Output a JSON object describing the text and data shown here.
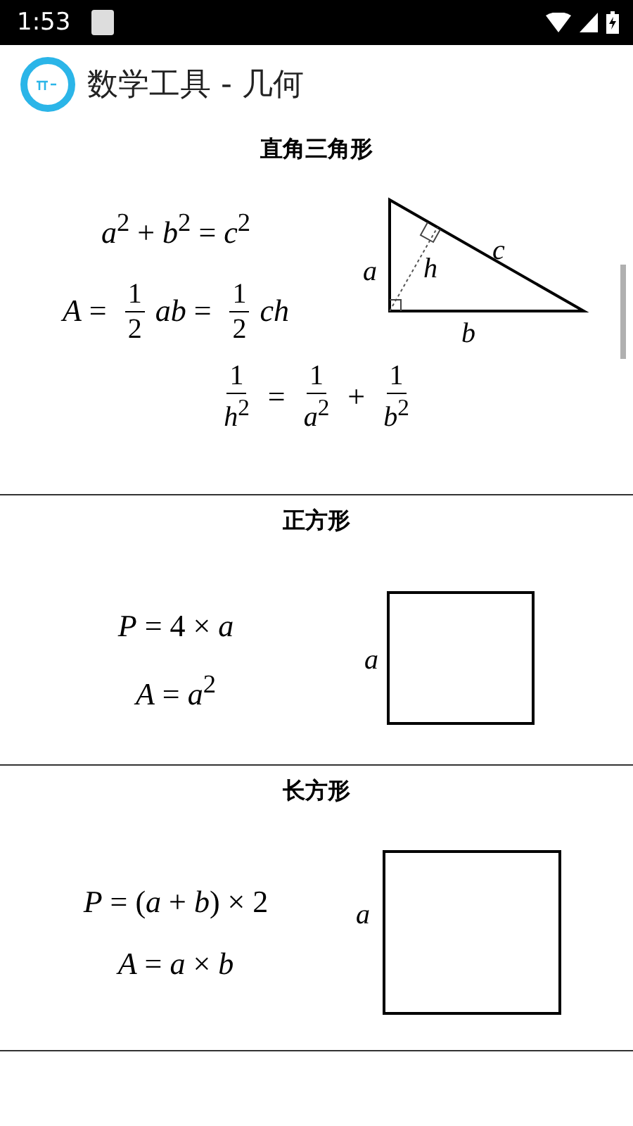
{
  "status_bar": {
    "time": "1:53"
  },
  "app_bar": {
    "title": "数学工具 - 几何"
  },
  "sections": [
    {
      "title": "直角三角形",
      "kind": "triangle",
      "formulas": [
        [
          {
            "t": "*a*$^{2}$ + *b*$^{2}$ = *c*$^{2}$"
          }
        ],
        [
          {
            "t": "*A* = "
          },
          {
            "num": "1",
            "den": "2"
          },
          {
            "t": "*ab* = "
          },
          {
            "num": "1",
            "den": "2"
          },
          {
            "t": "*ch*"
          }
        ]
      ],
      "wide_formulas": [
        [
          {
            "num": "1",
            "den": "*h*$^{2}$"
          },
          {
            "t": " = "
          },
          {
            "num": "1",
            "den": "*a*$^{2}$"
          },
          {
            "t": " + "
          },
          {
            "num": "1",
            "den": "*b*$^{2}$"
          }
        ]
      ],
      "labels": [
        "a",
        "h",
        "c",
        "b"
      ]
    },
    {
      "title": "正方形",
      "kind": "square",
      "formulas": [
        [
          {
            "t": "*P* = 4 × *a*"
          }
        ],
        [
          {
            "t": "*A* = *a*$^{2}$"
          }
        ]
      ],
      "labels": [
        "a"
      ]
    },
    {
      "title": "长方形",
      "kind": "rectangle",
      "formulas": [
        [
          {
            "t": "*P* = (*a* + *b*) × 2"
          }
        ],
        [
          {
            "t": "*A* = *a* × *b*"
          }
        ]
      ],
      "labels": [
        "a"
      ]
    }
  ]
}
